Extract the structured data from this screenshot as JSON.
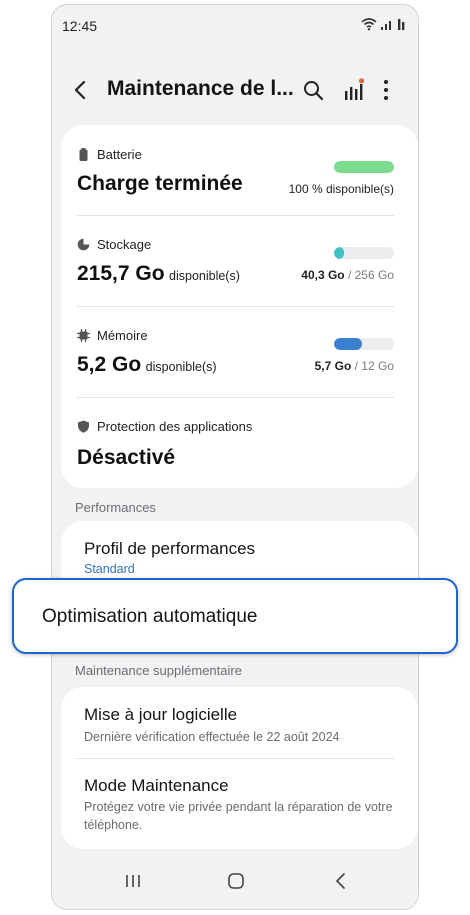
{
  "status_bar": {
    "time": "12:45"
  },
  "app_bar": {
    "title": "Maintenance de l..."
  },
  "battery": {
    "label": "Batterie",
    "value": "Charge terminée",
    "caption": "100 % disponible(s)",
    "fill_fraction": 1.0,
    "color": "#7ddb8e"
  },
  "storage": {
    "label": "Stockage",
    "value": "215,7 Go",
    "unit": "disponible(s)",
    "used": "40,3 Go",
    "total": "/ 256 Go",
    "fill_fraction": 0.16,
    "color": "#3fc1c4"
  },
  "memory": {
    "label": "Mémoire",
    "value": "5,2 Go",
    "unit": "disponible(s)",
    "used": "5,7 Go",
    "total": "/ 12 Go",
    "fill_fraction": 0.47,
    "color": "#3b7fd1"
  },
  "app_protection": {
    "label": "Protection des applications",
    "value": "Désactivé"
  },
  "performances": {
    "header": "Performances",
    "profile_title": "Profil de performances",
    "profile_value": "Standard",
    "auto_optimization": "Optimisation automatique"
  },
  "maintenance": {
    "header": "Maintenance supplémentaire",
    "software_update_title": "Mise à jour logicielle",
    "software_update_sub": "Dernière vérification effectuée le 22 août 2024",
    "maintenance_mode_title": "Mode Maintenance",
    "maintenance_mode_sub": "Protégez votre vie privée pendant la réparation de votre téléphone."
  },
  "colors": {
    "accent": "#1b66d3",
    "link": "#2e6fc8",
    "notification_dot": "#f0662f"
  },
  "icons": [
    "wifi-icon",
    "signal-icon",
    "back-icon",
    "search-icon",
    "chart-icon",
    "more-icon",
    "battery-icon",
    "storage-icon",
    "memory-icon",
    "shield-icon",
    "recents-icon",
    "home-icon",
    "nav-back-icon"
  ]
}
